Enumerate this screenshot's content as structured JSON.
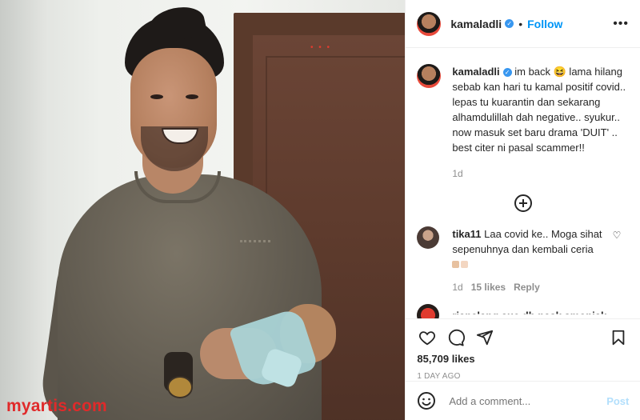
{
  "post": {
    "username": "kamaladli",
    "follow_label": "Follow",
    "more_label": "•••",
    "separator": "•"
  },
  "caption": {
    "username": "kamaladli",
    "text": " im back 😆 lama hilang sebab kan hari tu kamal positif covid.. lepas tu kuarantin dan sekarang alhamdulillah dah negative.. syukur.. now masuk set baru drama 'DUIT' .. best citer ni pasal scammer!!",
    "time": "1d"
  },
  "comments": [
    {
      "username": "tika11",
      "text": " Laa covid ke.. Moga sihat sepenuhnya dan kembali ceria",
      "time": "1d",
      "likes": "15 likes",
      "reply_label": "Reply"
    }
  ],
  "partial_comment": "rianalang aue dh nask smonjak",
  "stats": {
    "likes": "85,709 likes",
    "date": "1 DAY AGO"
  },
  "add_comment": {
    "placeholder": "Add a comment...",
    "post_label": "Post"
  },
  "watermark": "myartis.com",
  "colors": {
    "link_blue": "#0095f6",
    "post_disabled": "#b2dffc",
    "muted": "#8e8e8e",
    "watermark_red": "#e02a2a"
  },
  "icons": [
    "heart-icon",
    "comment-icon",
    "share-icon",
    "bookmark-icon",
    "emoji-icon",
    "add-comment-icon",
    "more-icon",
    "verified-icon"
  ]
}
